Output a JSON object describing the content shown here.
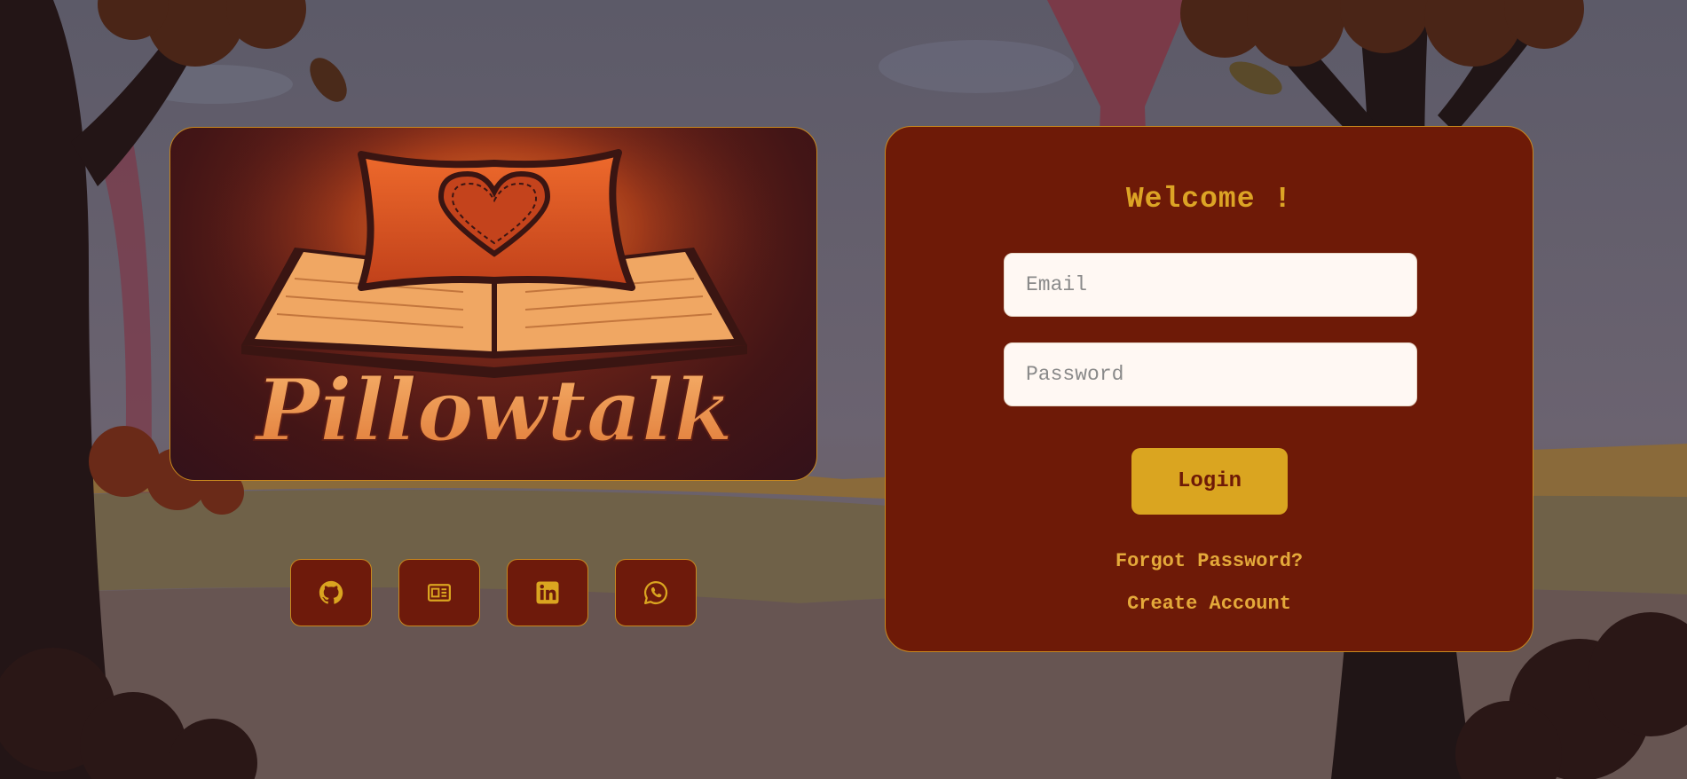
{
  "app": {
    "brand_name": "Pillowtalk"
  },
  "login": {
    "title": "Welcome !",
    "email_placeholder": "Email",
    "password_placeholder": "Password",
    "login_label": "Login",
    "forgot_label": "Forgot Password?",
    "create_label": "Create Account"
  },
  "social": [
    {
      "icon": "github-icon",
      "label": "GitHub"
    },
    {
      "icon": "portfolio-icon",
      "label": "Portfolio"
    },
    {
      "icon": "linkedin-icon",
      "label": "LinkedIn"
    },
    {
      "icon": "whatsapp-icon",
      "label": "WhatsApp"
    }
  ],
  "colors": {
    "card_bg": "#6e1a07",
    "accent_gold": "#daa520",
    "border_gold": "#c8881e",
    "input_bg": "#fff8f3"
  }
}
